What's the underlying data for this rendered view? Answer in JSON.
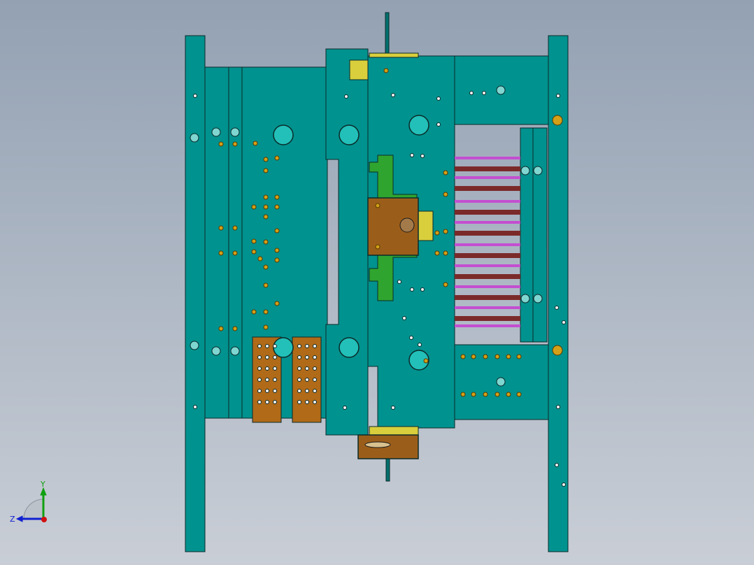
{
  "app": {
    "window_title": "",
    "viewport_mode": "front-view"
  },
  "colors": {
    "background_top": "#93a1b3",
    "background_bottom": "#c9ced6",
    "plate": "#00928e",
    "plate_dark": "#00706d",
    "outline": "#0b2a2a",
    "copper": "#b06a18",
    "copper_dark": "#7a4610",
    "slider_brown": "#9b5e1a",
    "lifter_green": "#2fa52f",
    "yellow_block": "#d9cf3c",
    "stripe_magenta": "#c34fd0",
    "stripe_maroon": "#7b2a2a",
    "hole_orange": "#d4a017",
    "axis_x": "#d01010",
    "axis_y": "#10a010",
    "axis_z": "#1020d0"
  },
  "triad": {
    "y_label": "Y",
    "z_label": "Z",
    "icon": "coordinate-triad-icon"
  }
}
